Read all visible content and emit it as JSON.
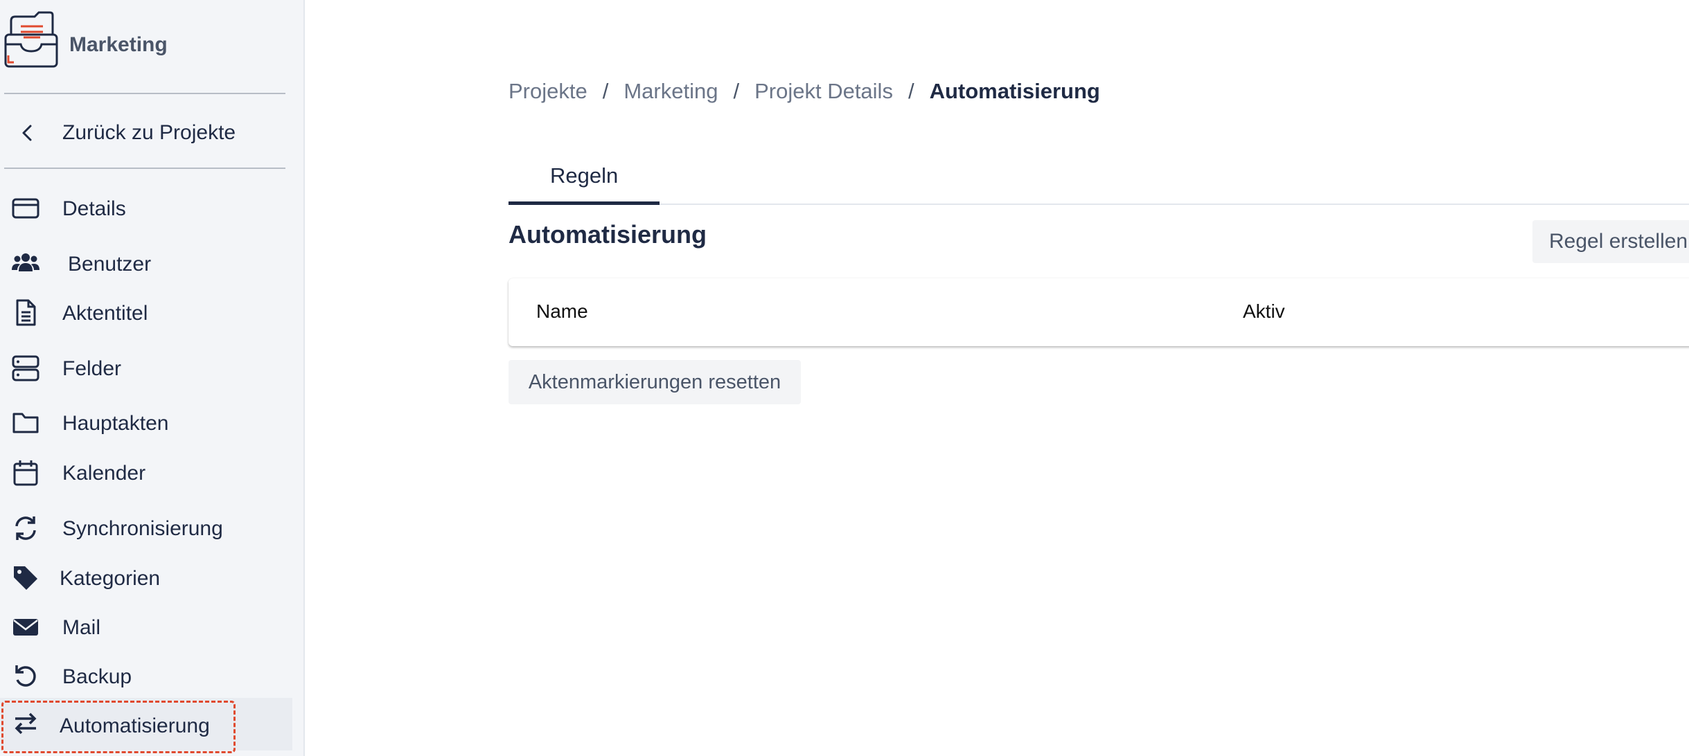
{
  "sidebar": {
    "brand_name": "Marketing",
    "back_label": "Zurück zu Projekte",
    "items": [
      {
        "label": "Details",
        "icon": "card-icon"
      },
      {
        "label": "Benutzer",
        "icon": "users-icon"
      },
      {
        "label": "Aktentitel",
        "icon": "document-icon"
      },
      {
        "label": "Felder",
        "icon": "server-icon"
      },
      {
        "label": "Hauptakten",
        "icon": "folder-icon"
      },
      {
        "label": "Kalender",
        "icon": "calendar-icon"
      },
      {
        "label": "Synchronisierung",
        "icon": "sync-icon"
      },
      {
        "label": "Kategorien",
        "icon": "tag-icon"
      },
      {
        "label": "Mail",
        "icon": "envelope-icon"
      },
      {
        "label": "Backup",
        "icon": "undo-icon"
      },
      {
        "label": "Automatisierung",
        "icon": "arrows-exchange-icon",
        "active": true
      }
    ]
  },
  "breadcrumb": {
    "items": [
      "Projekte",
      "Marketing",
      "Projekt Details"
    ],
    "separator": "/",
    "current": "Automatisierung"
  },
  "tabs": [
    {
      "label": "Regeln",
      "active": true
    }
  ],
  "section": {
    "title": "Automatisierung",
    "create_button": "Regel erstellen"
  },
  "table": {
    "columns": [
      "Name",
      "Aktiv"
    ]
  },
  "reset_button": "Aktenmarkierungen resetten",
  "colors": {
    "accent": "#e04a2f",
    "text": "#1f2a44",
    "sidebar_bg": "#f3f5f8"
  }
}
